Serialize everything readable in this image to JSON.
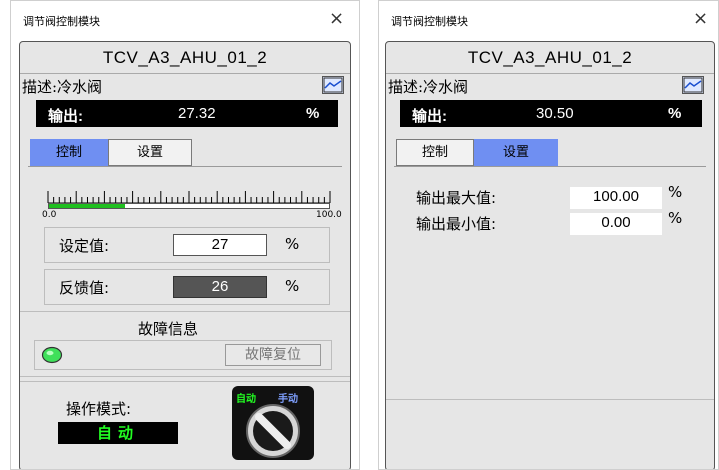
{
  "left": {
    "window_title": "调节阀控制模块",
    "close_glyph": "×",
    "tag": "TCV_A3_AHU_01_2",
    "description": "描述:冷水阀",
    "output_label": "输出:",
    "output_value": "27.32",
    "output_unit": "%",
    "tabs": [
      {
        "label": "控制",
        "active": true
      },
      {
        "label": "设置",
        "active": false
      }
    ],
    "scale_min": "0.0",
    "scale_max": "100.0",
    "scale_fill_fraction": 0.27,
    "setpoint_label": "设定值:",
    "setpoint_value": "27",
    "setpoint_unit": "%",
    "feedback_label": "反馈值:",
    "feedback_value": "26",
    "feedback_unit": "%",
    "fault_title": "故障信息",
    "fault_reset_label": "故障复位",
    "mode_label": "操作模式:",
    "mode_value": "自动",
    "switch_auto_label": "自动",
    "switch_manual_label": "手动"
  },
  "right": {
    "window_title": "调节阀控制模块",
    "close_glyph": "×",
    "tag": "TCV_A3_AHU_01_2",
    "description": "描述:冷水阀",
    "output_label": "输出:",
    "output_value": "30.50",
    "output_unit": "%",
    "tabs": [
      {
        "label": "控制",
        "active": false
      },
      {
        "label": "设置",
        "active": true
      }
    ],
    "max_label": "输出最大值:",
    "max_value": "100.00",
    "max_unit": "%",
    "min_label": "输出最小值:",
    "min_value": "0.00",
    "min_unit": "%"
  },
  "icons": [
    "trend-chart-icon",
    "status-lamp-icon",
    "selector-switch-icon",
    "close-icon"
  ],
  "colors": {
    "tab_active": "#6f8ff2",
    "output_bar": "#000000",
    "scale_fill": "#1fbf1f",
    "lamp": "#3fe05a",
    "mode_text": "#22ff22",
    "switch_auto": "#22ff22",
    "switch_manual": "#7fa0ff"
  }
}
